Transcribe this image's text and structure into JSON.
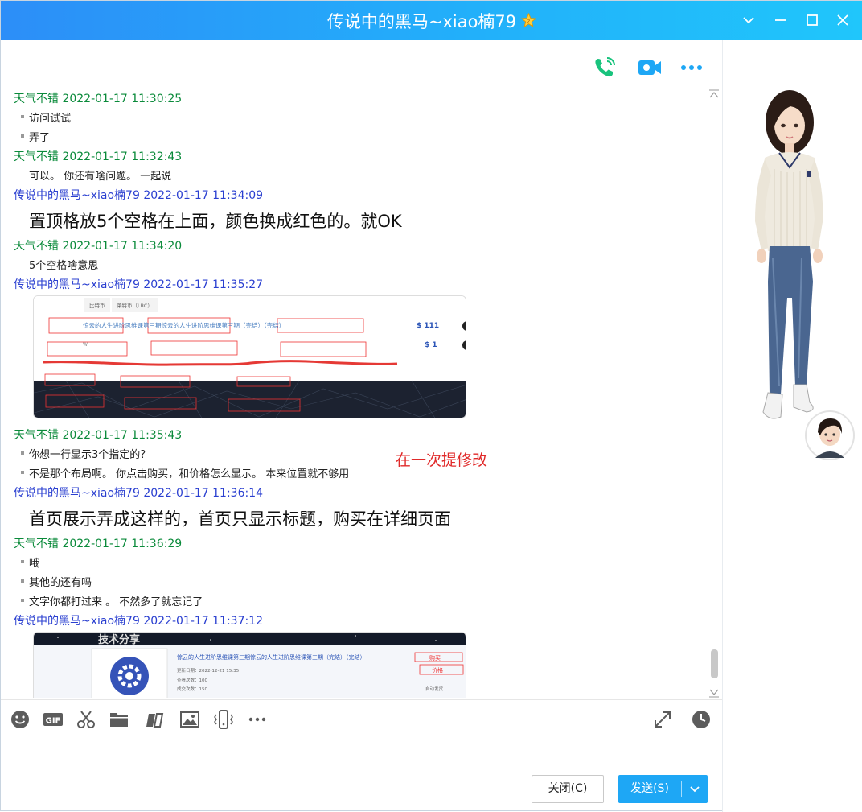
{
  "window": {
    "title": "传说中的黑马~xiao楠79"
  },
  "messages": [
    {
      "sender": "天气不错",
      "time": "2022-01-17 11:30:25",
      "lines": [
        "访问试试",
        "弄了"
      ]
    },
    {
      "sender": "天气不错",
      "time": "2022-01-17 11:32:43",
      "lines": [
        "可以。 你还有啥问题。 一起说"
      ]
    },
    {
      "sender": "传说中的黑马~xiao楠79",
      "time": "2022-01-17 11:34:09",
      "lines": [
        "置顶格放5个空格在上面，颜色换成红色的。就OK"
      ]
    },
    {
      "sender": "天气不错",
      "time": "2022-01-17 11:34:20",
      "lines": [
        "5个空格啥意思"
      ]
    },
    {
      "sender": "传说中的黑马~xiao楠79",
      "time": "2022-01-17 11:35:27",
      "lines": []
    },
    {
      "sender": "天气不错",
      "time": "2022-01-17 11:35:43",
      "lines": [
        "你想一行显示3个指定的?",
        "不是那个布局啊。 你点击购买，和价格怎么显示。 本来位置就不够用"
      ]
    },
    {
      "sender": "传说中的黑马~xiao楠79",
      "time": "2022-01-17 11:36:14",
      "lines": [
        "首页展示弄成这样的，首页只显示标题，购买在详细页面"
      ]
    },
    {
      "sender": "天气不错",
      "time": "2022-01-17 11:36:29",
      "lines": [
        "哦",
        "其他的还有吗",
        "文字你都打过来 。 不然多了就忘记了"
      ]
    },
    {
      "sender": "传说中的黑马~xiao楠79",
      "time": "2022-01-17 11:37:12",
      "lines": []
    }
  ],
  "annotation": "在一次提修改",
  "image1": {
    "tab1": "比特币",
    "tab2": "莱特币（LRC）",
    "title": "惊云的人生进阶思维课第三期惊云的人生进阶思维课第三期（完结）（完结）",
    "price1": "$ 111",
    "price2": "$ 1",
    "w": "W"
  },
  "image2": {
    "title": "惊云的人生进阶思维课第三期惊云的人生进阶思维课第三期（完结）（完结）",
    "buy": "购买",
    "price": "价格",
    "date": "更新日期：2022-12-21 15:35",
    "views": "查看次数：100",
    "deals": "成交次数：150",
    "auto": "自动发货",
    "banner": "技术分享"
  },
  "buttons": {
    "close": "关闭(",
    "close_key": "C",
    "close_end": ")",
    "send": "发送(",
    "send_key": "S",
    "send_end": ")"
  },
  "colors": {
    "titlebar_start": "#2c8ef8",
    "titlebar_end": "#20c6fb",
    "sender_other": "#0a8a3a",
    "sender_self": "#2a3fd0",
    "annotation": "#e02a2a",
    "send_button": "#1ea7f5"
  }
}
